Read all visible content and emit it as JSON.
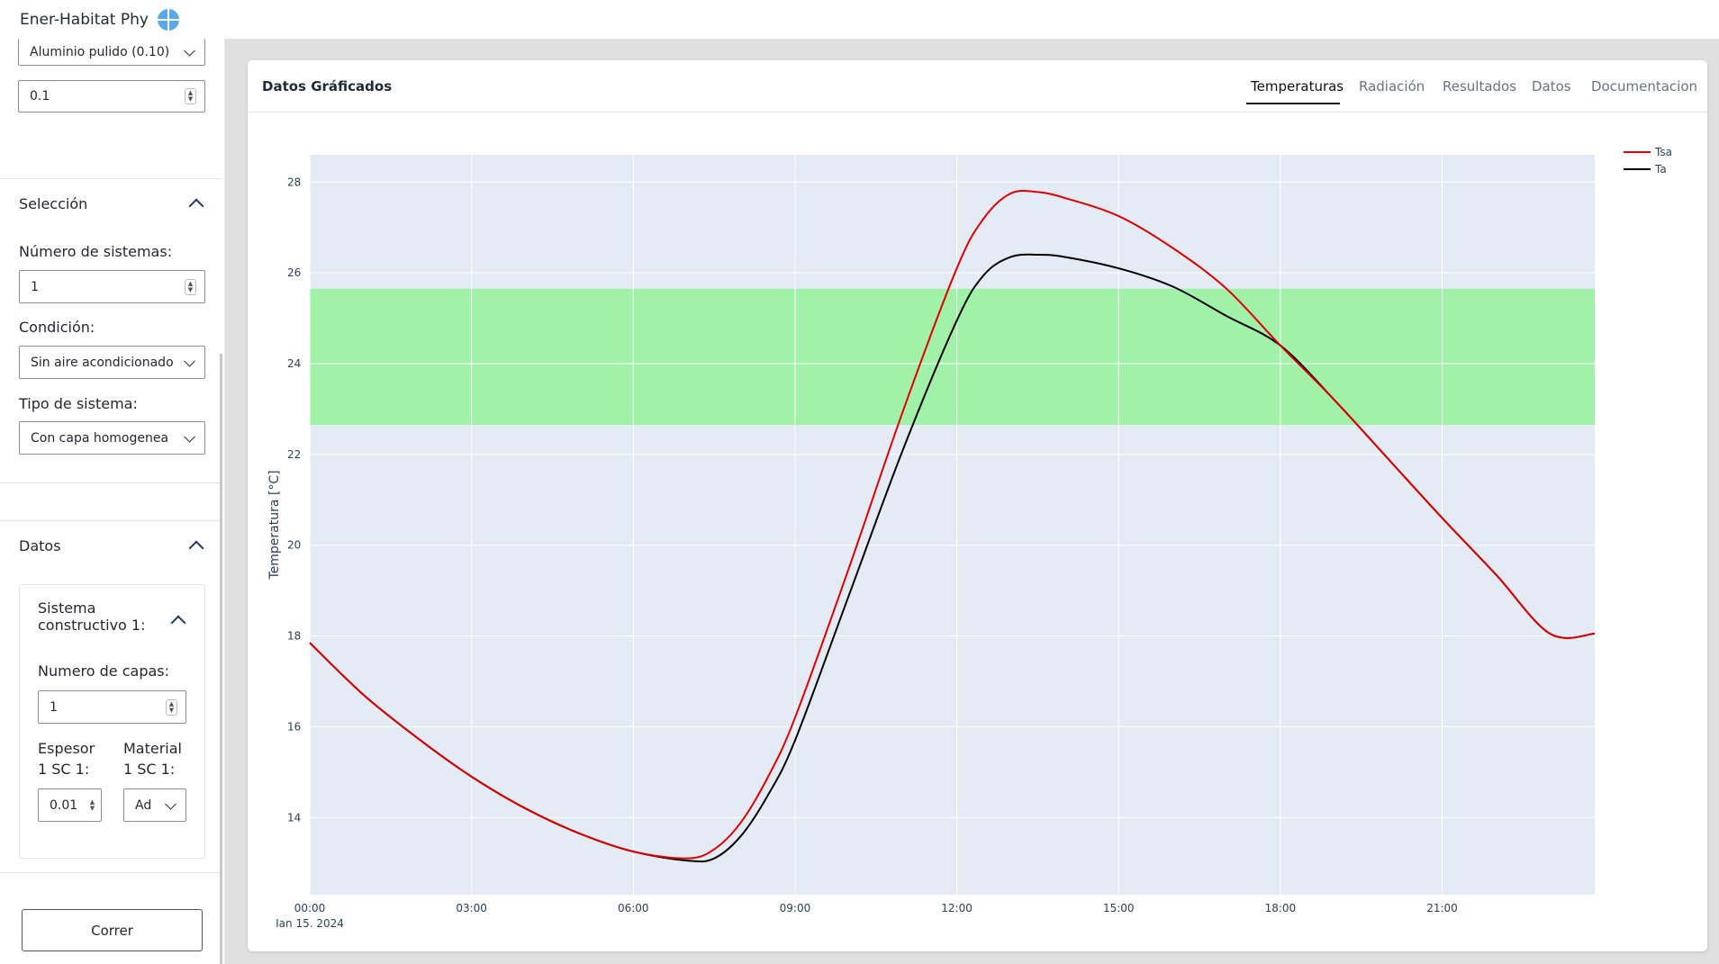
{
  "header": {
    "app_title": "Ener-Habitat Phy"
  },
  "sidebar": {
    "material_select": "Aluminio pulido (0.10)",
    "absorptance_value": "0.1",
    "seleccion": {
      "title": "Selección",
      "num_sistemas_label": "Número de sistemas:",
      "num_sistemas_value": "1",
      "condicion_label": "Condición:",
      "condicion_value": "Sin aire acondicionado",
      "tipo_label": "Tipo de sistema:",
      "tipo_value": "Con capa homogenea"
    },
    "datos": {
      "title": "Datos",
      "sistema_title_1": "Sistema",
      "sistema_title_2": "constructivo 1:",
      "num_capas_label": "Numero de capas:",
      "num_capas_value": "1",
      "espesor_label_1": "Espesor",
      "espesor_label_2": "1 SC 1:",
      "espesor_value": "0.01",
      "material_label_1": "Material",
      "material_label_2": "1 SC 1:",
      "material_value": "Ad"
    },
    "run_button": "Correr"
  },
  "card": {
    "title": "Datos Gráficados",
    "tabs": [
      "Temperaturas",
      "Radiación",
      "Resultados",
      "Datos",
      "Documentacion"
    ],
    "active_tab": "Temperaturas"
  },
  "colors": {
    "tsa": "#e00000",
    "ta": "#000000",
    "comfort_band": "#a1f1a9",
    "plot_bg": "#e5ebf5"
  },
  "chart_data": {
    "type": "line",
    "ylabel": "Temperatura [°C]",
    "xlabel": "",
    "date_label": "Jan 15, 2024",
    "x_tick_labels": [
      "00:00",
      "03:00",
      "06:00",
      "09:00",
      "12:00",
      "15:00",
      "18:00",
      "21:00"
    ],
    "y_ticks": [
      14,
      16,
      18,
      20,
      22,
      24,
      26,
      28
    ],
    "ylim": [
      12.3,
      28.6
    ],
    "xlim_hours": [
      0,
      23.83
    ],
    "comfort_band": [
      22.65,
      25.65
    ],
    "legend_position": "top-right",
    "series": [
      {
        "name": "Tsa",
        "color_key": "tsa",
        "x_hours": [
          0,
          1,
          2,
          3,
          4,
          5,
          6,
          7,
          7.5,
          8,
          8.5,
          9,
          10,
          11,
          12,
          12.5,
          13,
          13.5,
          14,
          15,
          16,
          17,
          18,
          19,
          20,
          21,
          22,
          23,
          23.83
        ],
        "values": [
          17.85,
          16.7,
          15.75,
          14.9,
          14.2,
          13.65,
          13.25,
          13.1,
          13.3,
          13.9,
          14.9,
          16.2,
          19.5,
          22.95,
          26.1,
          27.2,
          27.75,
          27.78,
          27.65,
          27.25,
          26.55,
          25.65,
          24.4,
          23.2,
          21.9,
          20.6,
          19.35,
          18.05,
          18.05
        ]
      },
      {
        "name": "Ta",
        "color_key": "ta",
        "x_hours": [
          0,
          1,
          2,
          3,
          4,
          5,
          6,
          7,
          7.5,
          8,
          8.5,
          9,
          10,
          11,
          12,
          12.5,
          13,
          13.5,
          14,
          15,
          16,
          17,
          18,
          19,
          20,
          21,
          22,
          23,
          23.83
        ],
        "values": [
          17.85,
          16.7,
          15.75,
          14.9,
          14.2,
          13.65,
          13.25,
          13.05,
          13.1,
          13.6,
          14.5,
          15.7,
          18.9,
          22.1,
          24.95,
          25.95,
          26.35,
          26.4,
          26.35,
          26.1,
          25.7,
          25.05,
          24.4,
          23.2,
          21.9,
          20.6,
          19.35,
          18.05,
          18.05
        ]
      }
    ]
  }
}
